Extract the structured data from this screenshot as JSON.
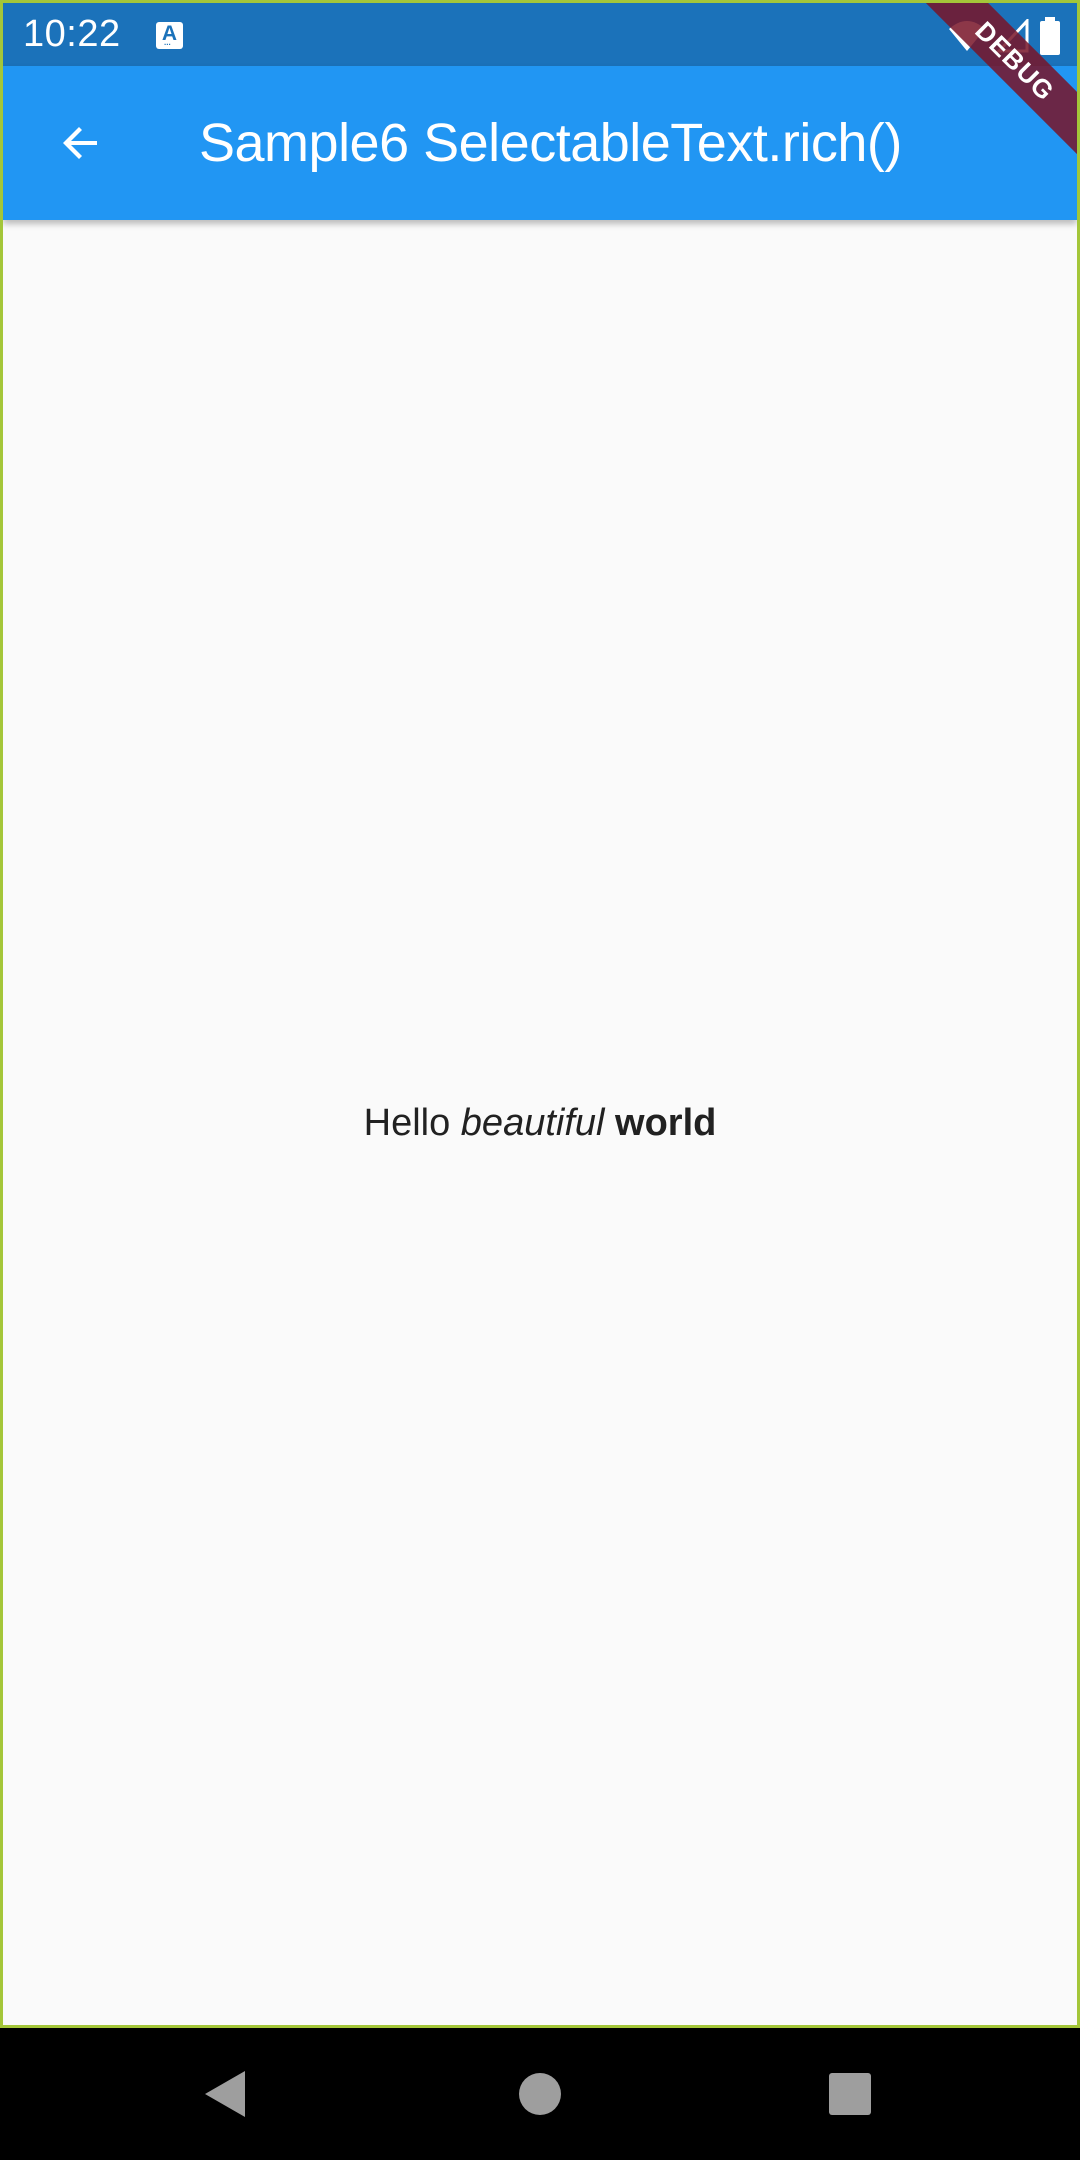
{
  "status_bar": {
    "time": "10:22",
    "notification_icon": "accessibility-a-icon",
    "icons": [
      "wifi-icon",
      "signal-icon",
      "battery-icon"
    ]
  },
  "app_bar": {
    "title": "Sample6 SelectableText.rich()",
    "back_icon": "arrow-back-icon"
  },
  "content": {
    "rich_text": {
      "plain": "Hello ",
      "italic": "beautiful",
      "space": " ",
      "bold": "world"
    }
  },
  "debug_banner": "DEBUG",
  "nav_bar": {
    "buttons": [
      "back-triangle-icon",
      "home-circle-icon",
      "recents-square-icon"
    ]
  },
  "colors": {
    "status_bar": "#1b72ba",
    "app_bar": "#2196f3",
    "background": "#fafafa",
    "text": "#212121",
    "debug_banner": "#78142a"
  }
}
